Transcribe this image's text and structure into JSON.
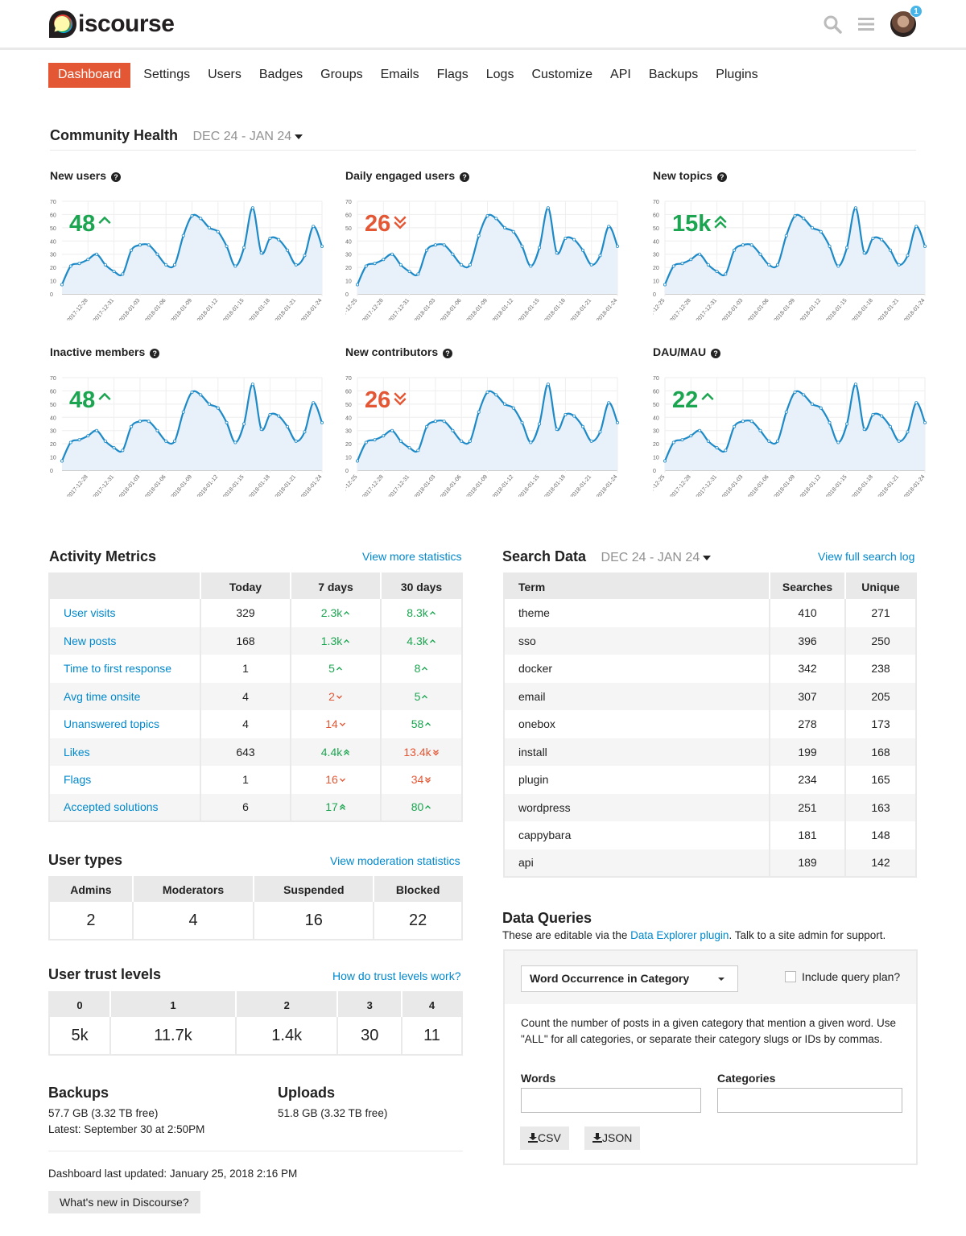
{
  "header": {
    "logo_text": "iscourse",
    "notification_count": "1",
    "icons": [
      "search-icon",
      "hamburger-menu-icon",
      "user-avatar"
    ]
  },
  "nav": {
    "items": [
      {
        "label": "Dashboard",
        "active": true
      },
      {
        "label": "Settings"
      },
      {
        "label": "Users"
      },
      {
        "label": "Badges"
      },
      {
        "label": "Groups"
      },
      {
        "label": "Emails"
      },
      {
        "label": "Flags"
      },
      {
        "label": "Logs"
      },
      {
        "label": "Customize"
      },
      {
        "label": "API"
      },
      {
        "label": "Backups"
      },
      {
        "label": "Plugins"
      }
    ]
  },
  "community_health": {
    "title": "Community Health",
    "date_range": "DEC 24 - JAN 24"
  },
  "chart_data": [
    {
      "type": "area",
      "title": "New users",
      "value": "48",
      "trend": "up",
      "trend_color": "#1ca551",
      "ylim": [
        0,
        70
      ],
      "yticks": [
        0,
        10,
        20,
        30,
        40,
        50,
        60,
        70
      ],
      "xticks": [
        "2017-12-28",
        "2017-12-31",
        "2018-01-03",
        "2018-01-06",
        "2018-01-09",
        "2018-01-12",
        "2018-01-15",
        "2018-01-18",
        "2018-01-21",
        "2018-01-24"
      ],
      "values": [
        7,
        21,
        23,
        26,
        30,
        22,
        17,
        15,
        33,
        37,
        37,
        30,
        22,
        22,
        44,
        59,
        57,
        50,
        47,
        36,
        21,
        35,
        65,
        31,
        42,
        41,
        33,
        22,
        29,
        51,
        36
      ]
    },
    {
      "type": "area",
      "title": "Daily engaged users",
      "value": "26",
      "trend": "double-down",
      "trend_color": "#e45735",
      "ylim": [
        0,
        70
      ],
      "yticks": [
        0,
        10,
        20,
        30,
        40,
        50,
        60,
        70
      ],
      "xticks": [
        "2017-12-25",
        "2017-12-28",
        "2017-12-31",
        "2018-01-03",
        "2018-01-06",
        "2018-01-09",
        "2018-01-12",
        "2018-01-15",
        "2018-01-18",
        "2018-01-21",
        "2018-01-24"
      ],
      "values": [
        7,
        21,
        23,
        26,
        30,
        22,
        17,
        15,
        33,
        37,
        37,
        30,
        22,
        22,
        44,
        59,
        57,
        50,
        47,
        36,
        21,
        35,
        65,
        31,
        42,
        41,
        33,
        22,
        29,
        51,
        36
      ]
    },
    {
      "type": "area",
      "title": "New topics",
      "value": "15k",
      "trend": "double-up",
      "trend_color": "#1ca551",
      "ylim": [
        0,
        70
      ],
      "yticks": [
        0,
        10,
        20,
        30,
        40,
        50,
        60,
        70
      ],
      "xticks": [
        "2017-12-25",
        "2017-12-28",
        "2017-12-31",
        "2018-01-03",
        "2018-01-06",
        "2018-01-09",
        "2018-01-12",
        "2018-01-15",
        "2018-01-18",
        "2018-01-21",
        "2018-01-24"
      ],
      "values": [
        7,
        21,
        23,
        26,
        30,
        22,
        17,
        15,
        33,
        37,
        37,
        30,
        22,
        22,
        44,
        59,
        57,
        50,
        47,
        36,
        21,
        35,
        65,
        31,
        42,
        41,
        33,
        22,
        29,
        51,
        36
      ]
    },
    {
      "type": "area",
      "title": "Inactive members",
      "value": "48",
      "trend": "up",
      "trend_color": "#1ca551",
      "ylim": [
        0,
        70
      ],
      "yticks": [
        0,
        10,
        20,
        30,
        40,
        50,
        60,
        70
      ],
      "xticks": [
        "2017-12-28",
        "2017-12-31",
        "2018-01-03",
        "2018-01-06",
        "2018-01-09",
        "2018-01-12",
        "2018-01-15",
        "2018-01-18",
        "2018-01-21",
        "2018-01-24"
      ],
      "values": [
        7,
        21,
        23,
        26,
        30,
        22,
        17,
        15,
        33,
        37,
        37,
        30,
        22,
        22,
        44,
        59,
        57,
        50,
        47,
        36,
        21,
        35,
        65,
        31,
        42,
        41,
        33,
        22,
        29,
        51,
        36
      ]
    },
    {
      "type": "area",
      "title": "New contributors",
      "value": "26",
      "trend": "double-down",
      "trend_color": "#e45735",
      "ylim": [
        0,
        70
      ],
      "yticks": [
        0,
        10,
        20,
        30,
        40,
        50,
        60,
        70
      ],
      "xticks": [
        "2017-12-25",
        "2017-12-28",
        "2017-12-31",
        "2018-01-03",
        "2018-01-06",
        "2018-01-09",
        "2018-01-12",
        "2018-01-15",
        "2018-01-18",
        "2018-01-21",
        "2018-01-24"
      ],
      "values": [
        7,
        21,
        23,
        26,
        30,
        22,
        17,
        15,
        33,
        37,
        37,
        30,
        22,
        22,
        44,
        59,
        57,
        50,
        47,
        36,
        21,
        35,
        65,
        31,
        42,
        41,
        33,
        22,
        29,
        51,
        36
      ]
    },
    {
      "type": "area",
      "title": "DAU/MAU",
      "value": "22",
      "trend": "up",
      "trend_color": "#1ca551",
      "ylim": [
        0,
        70
      ],
      "yticks": [
        0,
        10,
        20,
        30,
        40,
        50,
        60,
        70
      ],
      "xticks": [
        "2017-12-25",
        "2017-12-28",
        "2017-12-31",
        "2018-01-03",
        "2018-01-06",
        "2018-01-09",
        "2018-01-12",
        "2018-01-15",
        "2018-01-18",
        "2018-01-21",
        "2018-01-24"
      ],
      "values": [
        7,
        21,
        23,
        26,
        30,
        22,
        17,
        15,
        33,
        37,
        37,
        30,
        22,
        22,
        44,
        59,
        57,
        50,
        47,
        36,
        21,
        35,
        65,
        31,
        42,
        41,
        33,
        22,
        29,
        51,
        36
      ]
    }
  ],
  "activity_metrics": {
    "title": "Activity Metrics",
    "link": "View more statistics",
    "columns": [
      "",
      "Today",
      "7 days",
      "30 days"
    ],
    "rows": [
      {
        "label": "User visits",
        "today": "329",
        "d7": "2.3k",
        "d7_trend": "up",
        "d30": "8.3k",
        "d30_trend": "up"
      },
      {
        "label": "New posts",
        "today": "168",
        "d7": "1.3k",
        "d7_trend": "up",
        "d30": "4.3k",
        "d30_trend": "up"
      },
      {
        "label": "Time to first response",
        "today": "1",
        "d7": "5",
        "d7_trend": "up",
        "d30": "8",
        "d30_trend": "up"
      },
      {
        "label": "Avg time onsite",
        "today": "4",
        "d7": "2",
        "d7_trend": "down",
        "d30": "5",
        "d30_trend": "up"
      },
      {
        "label": "Unanswered topics",
        "today": "4",
        "d7": "14",
        "d7_trend": "down",
        "d30": "58",
        "d30_trend": "up"
      },
      {
        "label": "Likes",
        "today": "643",
        "d7": "4.4k",
        "d7_trend": "double-up",
        "d30": "13.4k",
        "d30_trend": "double-down"
      },
      {
        "label": "Flags",
        "today": "1",
        "d7": "16",
        "d7_trend": "down",
        "d30": "34",
        "d30_trend": "double-down"
      },
      {
        "label": "Accepted solutions",
        "today": "6",
        "d7": "17",
        "d7_trend": "double-up",
        "d30": "80",
        "d30_trend": "up"
      }
    ]
  },
  "search_data": {
    "title": "Search Data",
    "date_range": "DEC 24 - JAN 24",
    "link": "View full search log",
    "columns": [
      "Term",
      "Searches",
      "Unique"
    ],
    "rows": [
      [
        "theme",
        "410",
        "271"
      ],
      [
        "sso",
        "396",
        "250"
      ],
      [
        "docker",
        "342",
        "238"
      ],
      [
        "email",
        "307",
        "205"
      ],
      [
        "onebox",
        "278",
        "173"
      ],
      [
        "install",
        "199",
        "168"
      ],
      [
        "plugin",
        "234",
        "165"
      ],
      [
        "wordpress",
        "251",
        "163"
      ],
      [
        "cappybara",
        "181",
        "148"
      ],
      [
        "api",
        "189",
        "142"
      ]
    ]
  },
  "user_types": {
    "title": "User types",
    "link": "View moderation statistics",
    "columns": [
      "Admins",
      "Moderators",
      "Suspended",
      "Blocked"
    ],
    "values": [
      "2",
      "4",
      "16",
      "22"
    ]
  },
  "trust_levels": {
    "title": "User trust levels",
    "link": "How do trust levels work?",
    "columns": [
      "0",
      "1",
      "2",
      "3",
      "4"
    ],
    "values": [
      "5k",
      "11.7k",
      "1.4k",
      "30",
      "11"
    ]
  },
  "backups": {
    "title": "Backups",
    "size": "57.7 GB (3.32 TB free)",
    "latest": "Latest: September 30 at 2:50PM"
  },
  "uploads": {
    "title": "Uploads",
    "size": "51.8 GB (3.32 TB free)"
  },
  "footer": {
    "last_updated": "Dashboard last updated: January 25, 2018 2:16 PM",
    "whats_new": "What's new in Discourse?"
  },
  "data_queries": {
    "title": "Data Queries",
    "desc_prefix": "These are editable via the ",
    "desc_link": "Data Explorer plugin",
    "desc_suffix": ". Talk to a site admin for support.",
    "selected_query": "Word Occurrence in Category",
    "include_plan_label": "Include query plan?",
    "include_plan_checked": false,
    "query_desc": "Count the number of posts in a given category that mention a given word. Use \"ALL\" for all categories, or separate their category slugs or IDs by commas.",
    "words_label": "Words",
    "words_value": "",
    "categories_label": "Categories",
    "categories_value": "",
    "csv_label": "CSV",
    "json_label": "JSON"
  },
  "trend_glyphs": {
    "up": "^",
    "down": "v",
    "double-up": "˄",
    "double-down": "˅"
  },
  "colors": {
    "accent": "#e45735",
    "link": "#0088cc",
    "green": "#1ca551",
    "chart_line": "#1d8ac7",
    "chart_fill": "#e8f1fa"
  }
}
